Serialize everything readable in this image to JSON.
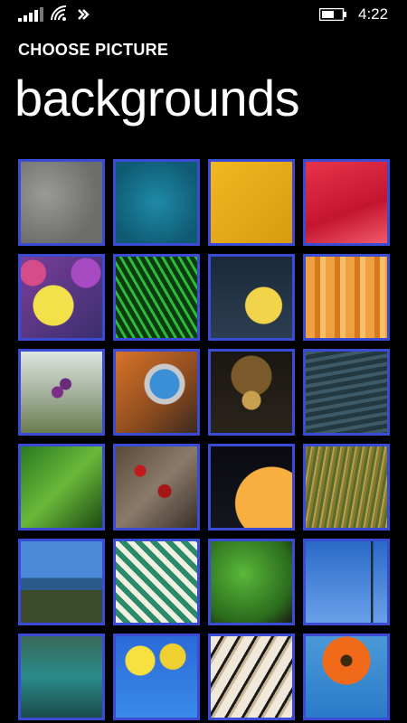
{
  "status": {
    "time": "4:22",
    "icons": [
      "signal-icon",
      "wifi-icon",
      "nfc-icon",
      "battery-icon"
    ]
  },
  "header": {
    "subtitle": "CHOOSE PICTURE",
    "title": "backgrounds"
  },
  "theme": {
    "accent": "#3a4bd6",
    "background": "#000000"
  },
  "backgrounds": [
    {
      "name": "concrete"
    },
    {
      "name": "teal-fabric"
    },
    {
      "name": "yellow-leaf-texture"
    },
    {
      "name": "red-petals"
    },
    {
      "name": "glass-balls"
    },
    {
      "name": "green-straws"
    },
    {
      "name": "yellow-flower-water"
    },
    {
      "name": "orange-wood"
    },
    {
      "name": "purple-berries"
    },
    {
      "name": "diving-helmet"
    },
    {
      "name": "door-knocker"
    },
    {
      "name": "ocean-water"
    },
    {
      "name": "green-leaves"
    },
    {
      "name": "red-flowers-stairs"
    },
    {
      "name": "orange-egg"
    },
    {
      "name": "tall-grass"
    },
    {
      "name": "coastal-view"
    },
    {
      "name": "striped-chair"
    },
    {
      "name": "green-foliage"
    },
    {
      "name": "blue-sky-pole"
    },
    {
      "name": "canal-boat"
    },
    {
      "name": "yellow-flowers-blue"
    },
    {
      "name": "piano-keys"
    },
    {
      "name": "orange-gerbera"
    }
  ]
}
